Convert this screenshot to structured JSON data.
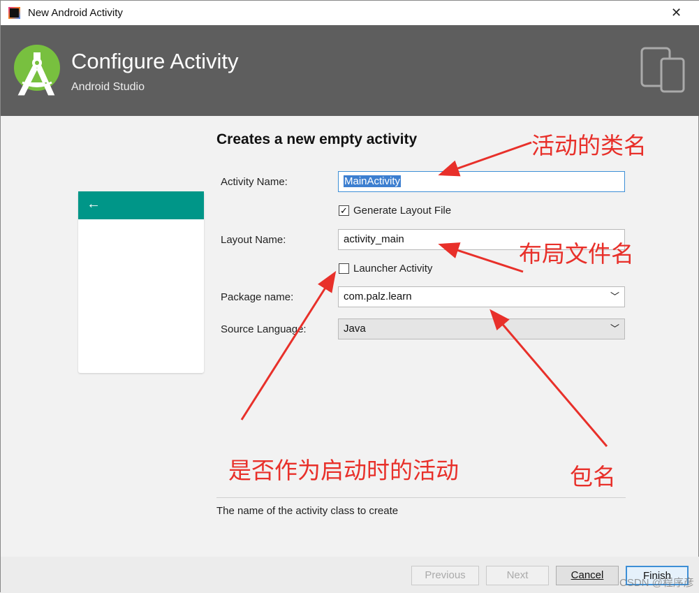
{
  "window": {
    "title": "New Android Activity",
    "close": "✕"
  },
  "header": {
    "title": "Configure Activity",
    "subtitle": "Android Studio"
  },
  "form": {
    "heading": "Creates a new empty activity",
    "activity_name_label": "Activity Name:",
    "activity_name": "MainActivity",
    "generate_layout_label": "Generate Layout File",
    "generate_layout_checked": true,
    "layout_name_label": "Layout Name:",
    "layout_name": "activity_main",
    "launcher_label": "Launcher Activity",
    "launcher_checked": false,
    "package_label": "Package name:",
    "package": "com.palz.learn",
    "language_label": "Source Language:",
    "language": "Java"
  },
  "help_text": "The name of the activity class to create",
  "buttons": {
    "previous": "Previous",
    "next": "Next",
    "cancel": "Cancel",
    "finish": "Finish"
  },
  "annotations": {
    "class_name": "活动的类名",
    "layout_file": "布局文件名",
    "launcher": "是否作为启动时的活动",
    "package": "包名"
  },
  "watermark": "CSDN @程序彦",
  "colors": {
    "header": "#5e5e5e",
    "preview_bar": "#009688",
    "annotation": "#e8302a",
    "focus": "#3d8fd6"
  }
}
